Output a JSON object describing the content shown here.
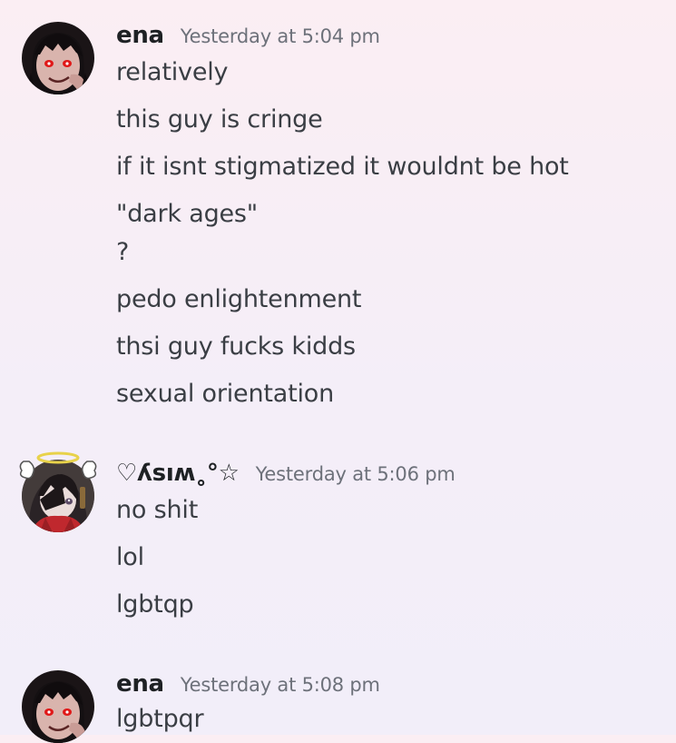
{
  "groups": [
    {
      "username": "ena",
      "timestamp": "Yesterday at 5:04 pm",
      "messages": [
        "relatively",
        "this guy is cringe",
        "if it isnt stigmatized it wouldnt be hot",
        "\"dark ages\"",
        "?",
        "pedo enlightenment",
        "thsi guy fucks kidds",
        "sexual orientation"
      ]
    },
    {
      "username": "♡ʎsıʍ˳°☆",
      "timestamp": "Yesterday at 5:06 pm",
      "messages": [
        "no shit",
        "lol",
        "lgbtqp"
      ]
    },
    {
      "username": "ena",
      "timestamp": "Yesterday at 5:08 pm",
      "messages": [
        "lgbtpqr"
      ]
    }
  ],
  "colors": {
    "username": "#1e2124",
    "timestamp": "#6d717a",
    "message_text": "#3a3e44",
    "ena_eyes": "#e01818",
    "wish_scarf": "#c0282e",
    "halo": "#e8d24a"
  },
  "icons": {
    "avatar_ena": "avatar-ena-icon",
    "avatar_wish": "avatar-wish-icon",
    "halo": "halo-wings-icon"
  }
}
